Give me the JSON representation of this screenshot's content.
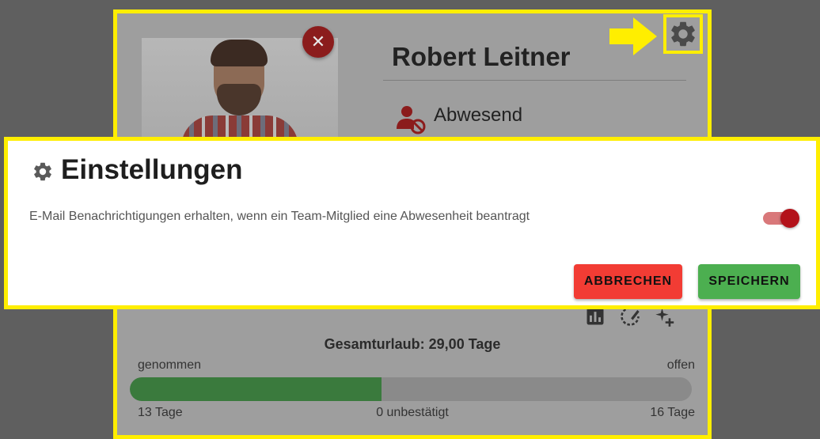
{
  "profile": {
    "close_symbol": "✕",
    "name": "Robert Leitner",
    "status": "Abwesend",
    "status_icon": "person-blocked-icon",
    "settings_icon": "gear-icon",
    "toolbar_icons": [
      "bar-chart-icon",
      "edit-timer-icon",
      "add-sparkle-icon"
    ]
  },
  "vacation": {
    "total_label": "Gesamturlaub: 29,00 Tage",
    "taken_label": "genommen",
    "open_label": "offen",
    "taken_days": "13 Tage",
    "unconfirmed": "0 unbestätigt",
    "open_days": "16 Tage",
    "taken_fraction": 0.448
  },
  "dialog": {
    "icon": "gear-icon",
    "title": "Einstellungen",
    "setting_text": "E-Mail Benachrichtigungen erhalten, wenn ein Team-Mitglied eine Abwesenheit beantragt",
    "toggle_on": true,
    "cancel_label": "ABBRECHEN",
    "save_label": "SPEICHERN"
  },
  "colors": {
    "highlight": "#ffee00",
    "accent_red": "#b3121a",
    "cancel": "#f23c34",
    "save": "#4caf50",
    "progress": "#3a7a3d"
  }
}
